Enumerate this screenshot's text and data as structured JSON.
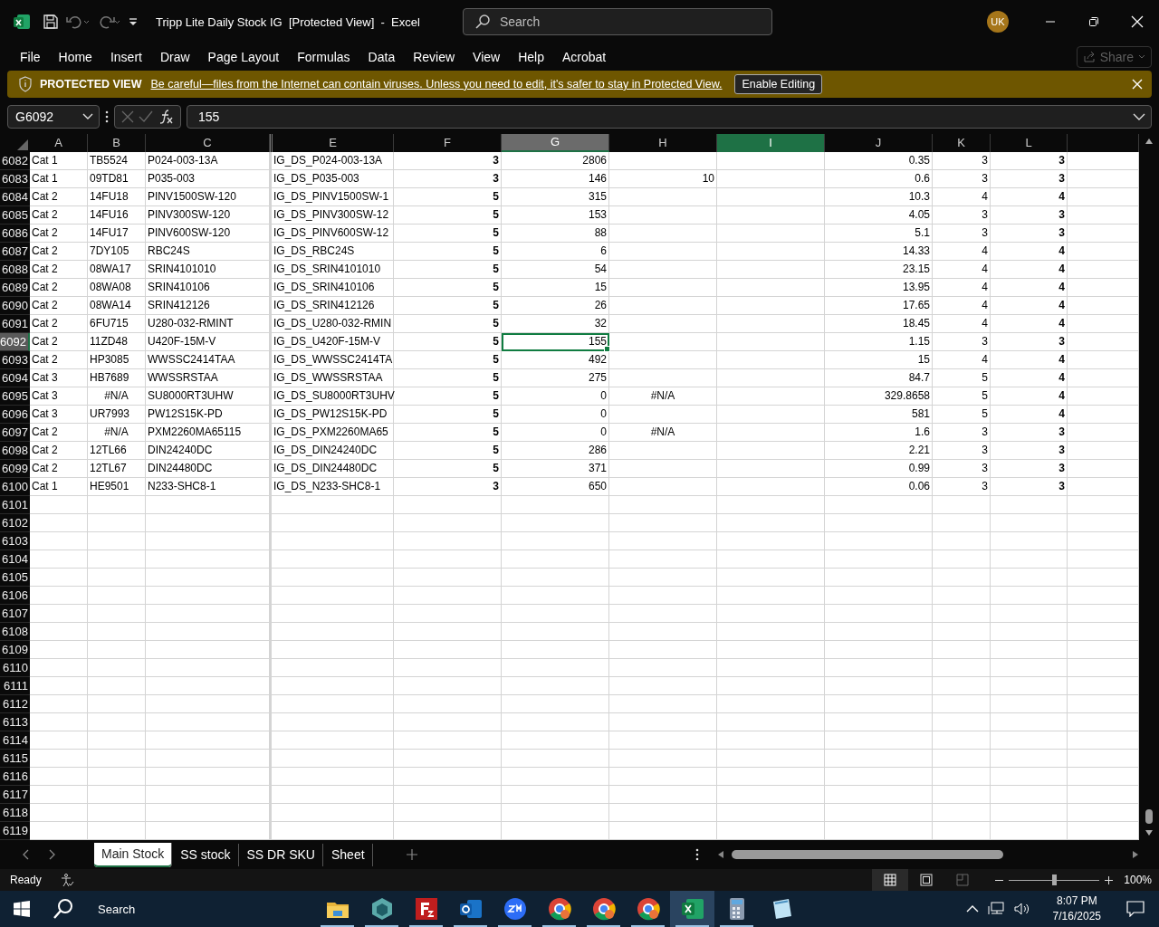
{
  "window": {
    "title": "Tripp Lite Daily Stock IG  [Protected View]  -  Excel",
    "search_placeholder": "Search",
    "user_initials": "UK"
  },
  "ribbon_tabs": [
    "File",
    "Home",
    "Insert",
    "Draw",
    "Page Layout",
    "Formulas",
    "Data",
    "Review",
    "View",
    "Help",
    "Acrobat"
  ],
  "share_button": {
    "label": "Share",
    "disabled": true
  },
  "protected_view": {
    "title": "PROTECTED VIEW",
    "message": "Be careful—files from the Internet can contain viruses. Unless you need to edit, it's safer to stay in Protected View.",
    "button": "Enable Editing"
  },
  "formula_bar": {
    "name_box": "G6092",
    "value": "155"
  },
  "columns": [
    {
      "label": "A",
      "kind": "text",
      "selected": false,
      "highlighted": false,
      "hidden_before": false
    },
    {
      "label": "B",
      "kind": "text",
      "selected": false,
      "highlighted": false,
      "hidden_before": false
    },
    {
      "label": "C",
      "kind": "text",
      "selected": false,
      "highlighted": false,
      "hidden_before": false
    },
    {
      "label": "E",
      "kind": "text",
      "selected": false,
      "highlighted": false,
      "hidden_before": true
    },
    {
      "label": "F",
      "kind": "emphasis",
      "selected": false,
      "highlighted": false,
      "hidden_before": false
    },
    {
      "label": "G",
      "kind": "number",
      "selected": true,
      "highlighted": false,
      "hidden_before": false
    },
    {
      "label": "H",
      "kind": "number",
      "selected": false,
      "highlighted": false,
      "hidden_before": false
    },
    {
      "label": "I",
      "kind": "number",
      "selected": false,
      "highlighted": true,
      "hidden_before": false
    },
    {
      "label": "J",
      "kind": "number",
      "selected": false,
      "highlighted": false,
      "hidden_before": false
    },
    {
      "label": "K",
      "kind": "number",
      "selected": false,
      "highlighted": false,
      "hidden_before": false
    },
    {
      "label": "L",
      "kind": "emphasis",
      "selected": false,
      "highlighted": false,
      "hidden_before": false
    }
  ],
  "rows": [
    {
      "row": "6082",
      "selected": false,
      "cells": [
        "Cat 1",
        "TB5524",
        "P024-003-13A",
        "IG_DS_P024-003-13A",
        "3",
        "2806",
        null,
        null,
        "0.35",
        "3",
        "3"
      ]
    },
    {
      "row": "6083",
      "selected": false,
      "cells": [
        "Cat 1",
        "09TD81",
        "P035-003",
        "IG_DS_P035-003",
        "3",
        "146",
        "10",
        null,
        "0.6",
        "3",
        "3"
      ]
    },
    {
      "row": "6084",
      "selected": false,
      "cells": [
        "Cat 2",
        "14FU18",
        "PINV1500SW-120",
        "IG_DS_PINV1500SW-1",
        "5",
        "315",
        null,
        null,
        "10.3",
        "4",
        "4"
      ]
    },
    {
      "row": "6085",
      "selected": false,
      "cells": [
        "Cat 2",
        "14FU16",
        "PINV300SW-120",
        "IG_DS_PINV300SW-12",
        "5",
        "153",
        null,
        null,
        "4.05",
        "3",
        "3"
      ]
    },
    {
      "row": "6086",
      "selected": false,
      "cells": [
        "Cat 2",
        "14FU17",
        "PINV600SW-120",
        "IG_DS_PINV600SW-12",
        "5",
        "88",
        null,
        null,
        "5.1",
        "3",
        "3"
      ]
    },
    {
      "row": "6087",
      "selected": false,
      "cells": [
        "Cat 2",
        "7DY105",
        "RBC24S",
        "IG_DS_RBC24S",
        "5",
        "6",
        null,
        null,
        "14.33",
        "4",
        "4"
      ]
    },
    {
      "row": "6088",
      "selected": false,
      "cells": [
        "Cat 2",
        "08WA17",
        "SRIN4101010",
        "IG_DS_SRIN4101010",
        "5",
        "54",
        null,
        null,
        "23.15",
        "4",
        "4"
      ]
    },
    {
      "row": "6089",
      "selected": false,
      "cells": [
        "Cat 2",
        "08WA08",
        "SRIN410106",
        "IG_DS_SRIN410106",
        "5",
        "15",
        null,
        null,
        "13.95",
        "4",
        "4"
      ]
    },
    {
      "row": "6090",
      "selected": false,
      "cells": [
        "Cat 2",
        "08WA14",
        "SRIN412126",
        "IG_DS_SRIN412126",
        "5",
        "26",
        null,
        null,
        "17.65",
        "4",
        "4"
      ]
    },
    {
      "row": "6091",
      "selected": false,
      "cells": [
        "Cat 2",
        "6FU715",
        "U280-032-RMINT",
        "IG_DS_U280-032-RMIN",
        "5",
        "32",
        null,
        null,
        "18.45",
        "4",
        "4"
      ]
    },
    {
      "row": "6092",
      "selected": true,
      "cells": [
        "Cat 2",
        "11ZD48",
        "U420F-15M-V",
        "IG_DS_U420F-15M-V",
        "5",
        "155",
        null,
        null,
        "1.15",
        "3",
        "3"
      ]
    },
    {
      "row": "6093",
      "selected": false,
      "cells": [
        "Cat 2",
        "HP3085",
        "WWSSC2414TAA",
        "IG_DS_WWSSC2414TA",
        "5",
        "492",
        null,
        null,
        "15",
        "4",
        "4"
      ]
    },
    {
      "row": "6094",
      "selected": false,
      "cells": [
        "Cat 3",
        "HB7689",
        "WWSSRSTAA",
        "IG_DS_WWSSRSTAA",
        "5",
        "275",
        null,
        null,
        "84.7",
        "5",
        "4"
      ]
    },
    {
      "row": "6095",
      "selected": false,
      "cells": [
        "Cat 3",
        {
          "text": "#N/A",
          "kind": "error"
        },
        "SU8000RT3UHW",
        "IG_DS_SU8000RT3UHV",
        "5",
        "0",
        {
          "text": "#N/A",
          "kind": "error"
        },
        null,
        "329.8658",
        "5",
        "4"
      ]
    },
    {
      "row": "6096",
      "selected": false,
      "cells": [
        "Cat 3",
        "UR7993",
        "PW12S15K-PD",
        "IG_DS_PW12S15K-PD",
        "5",
        "0",
        null,
        null,
        "581",
        "5",
        "4"
      ]
    },
    {
      "row": "6097",
      "selected": false,
      "cells": [
        "Cat 2",
        {
          "text": "#N/A",
          "kind": "error"
        },
        "PXM2260MA65115",
        "IG_DS_PXM2260MA65",
        "5",
        "0",
        {
          "text": "#N/A",
          "kind": "error"
        },
        null,
        "1.6",
        "3",
        "3"
      ]
    },
    {
      "row": "6098",
      "selected": false,
      "cells": [
        "Cat 2",
        "12TL66",
        "DIN24240DC",
        "IG_DS_DIN24240DC",
        "5",
        "286",
        null,
        null,
        "2.21",
        "3",
        "3"
      ]
    },
    {
      "row": "6099",
      "selected": false,
      "cells": [
        "Cat 2",
        "12TL67",
        "DIN24480DC",
        "IG_DS_DIN24480DC",
        "5",
        "371",
        null,
        null,
        "0.99",
        "3",
        "3"
      ]
    },
    {
      "row": "6100",
      "selected": false,
      "cells": [
        "Cat 1",
        "HE9501",
        "N233-SHC8-1",
        "IG_DS_N233-SHC8-1",
        "3",
        "650",
        null,
        null,
        "0.06",
        "3",
        "3"
      ]
    },
    {
      "row": "6101",
      "selected": false
    },
    {
      "row": "6102",
      "selected": false
    },
    {
      "row": "6103",
      "selected": false
    },
    {
      "row": "6104",
      "selected": false
    },
    {
      "row": "6105",
      "selected": false
    },
    {
      "row": "6106",
      "selected": false
    },
    {
      "row": "6107",
      "selected": false
    },
    {
      "row": "6108",
      "selected": false
    },
    {
      "row": "6109",
      "selected": false
    },
    {
      "row": "6110",
      "selected": false
    },
    {
      "row": "6111",
      "selected": false
    },
    {
      "row": "6112",
      "selected": false
    },
    {
      "row": "6113",
      "selected": false
    },
    {
      "row": "6114",
      "selected": false
    },
    {
      "row": "6115",
      "selected": false
    },
    {
      "row": "6116",
      "selected": false
    },
    {
      "row": "6117",
      "selected": false
    },
    {
      "row": "6118",
      "selected": false
    },
    {
      "row": "6119",
      "selected": false
    }
  ],
  "sheet_tabs": [
    {
      "label": "Main Stock",
      "selected": true
    },
    {
      "label": "SS stock",
      "selected": false
    },
    {
      "label": "SS DR SKU",
      "selected": false
    },
    {
      "label": "Sheet",
      "selected": false
    }
  ],
  "status_bar": {
    "status": "Ready",
    "zoom": "100%",
    "zoom_slider": {
      "level": 0.5
    }
  },
  "taskbar": {
    "search": "Search",
    "time": "8:07 PM",
    "date": "7/16/2025",
    "apps": [
      {
        "kind": "folder",
        "running": true,
        "active": false
      },
      {
        "kind": "cube",
        "running": true,
        "active": false
      },
      {
        "kind": "filezilla",
        "running": true,
        "active": false
      },
      {
        "kind": "outlook",
        "running": true,
        "active": false
      },
      {
        "kind": "zoom",
        "running": true,
        "active": false
      },
      {
        "kind": "chrome",
        "running": true,
        "active": false
      },
      {
        "kind": "chrome",
        "running": true,
        "active": false
      },
      {
        "kind": "chrome",
        "running": true,
        "active": false
      },
      {
        "kind": "excel",
        "running": true,
        "active": true
      },
      {
        "kind": "calculator",
        "running": true,
        "active": false
      },
      {
        "kind": "notepad",
        "running": false,
        "active": false
      }
    ]
  }
}
